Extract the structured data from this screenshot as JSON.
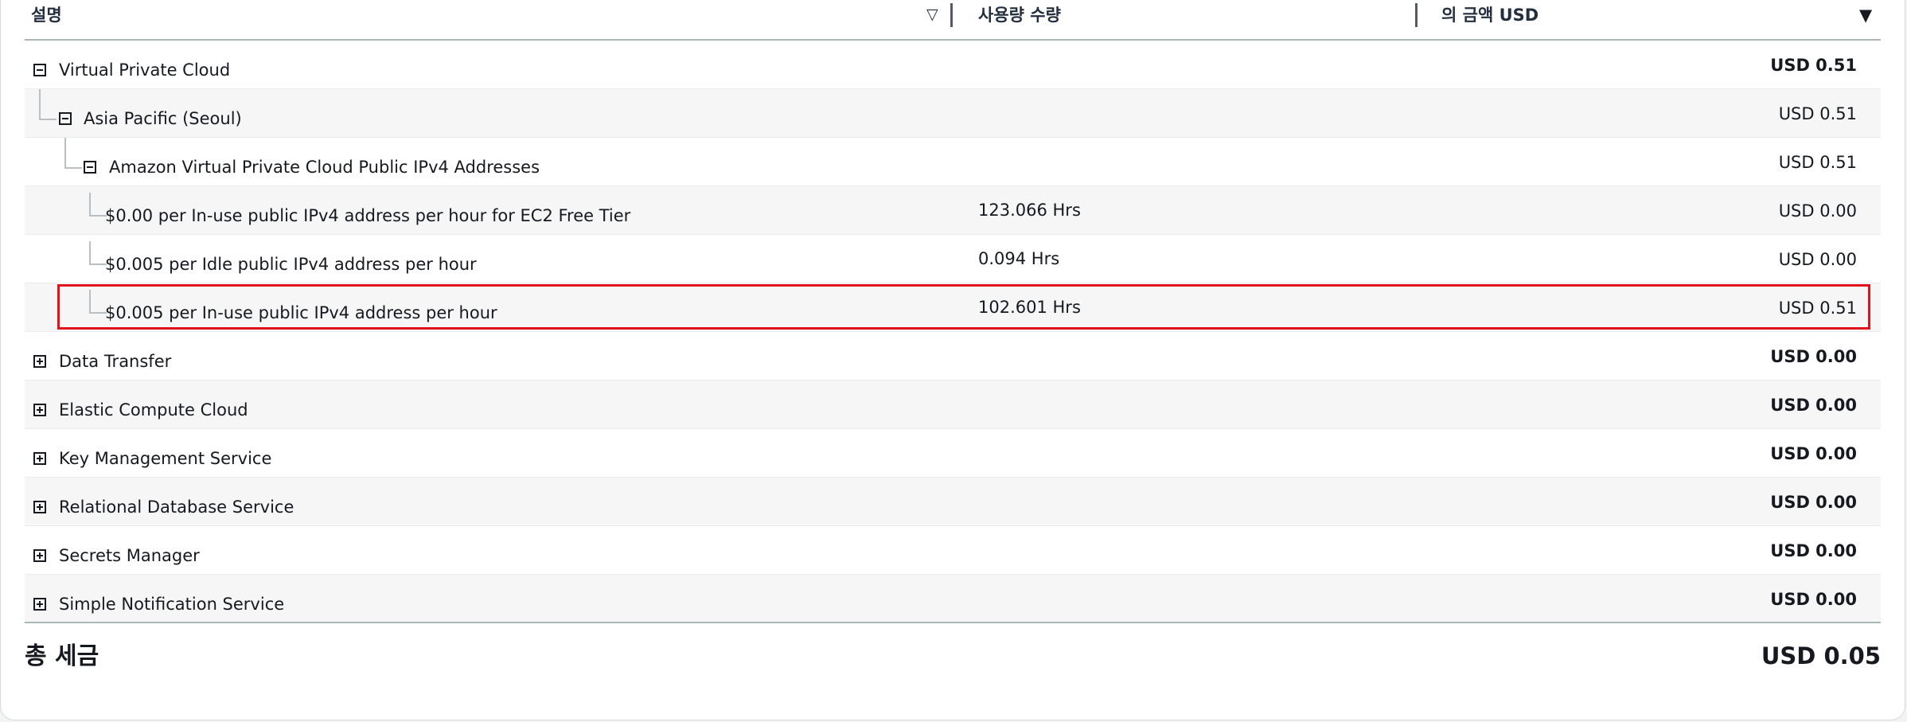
{
  "columns": {
    "description": "설명",
    "usage": "사용량 수량",
    "amount": "의 금액 USD"
  },
  "rows": [
    {
      "label": "Virtual Private Cloud",
      "usage": "",
      "amount": "USD 0.51"
    },
    {
      "label": "Asia Pacific (Seoul)",
      "usage": "",
      "amount": "USD 0.51"
    },
    {
      "label": "Amazon Virtual Private Cloud Public IPv4 Addresses",
      "usage": "",
      "amount": "USD 0.51"
    },
    {
      "label": "$0.00 per In-use public IPv4 address per hour for EC2 Free Tier",
      "usage": "123.066 Hrs",
      "amount": "USD 0.00"
    },
    {
      "label": "$0.005 per Idle public IPv4 address per hour",
      "usage": "0.094 Hrs",
      "amount": "USD 0.00"
    },
    {
      "label": "$0.005 per In-use public IPv4 address per hour",
      "usage": "102.601 Hrs",
      "amount": "USD 0.51"
    },
    {
      "label": "Data Transfer",
      "usage": "",
      "amount": "USD 0.00"
    },
    {
      "label": "Elastic Compute Cloud",
      "usage": "",
      "amount": "USD 0.00"
    },
    {
      "label": "Key Management Service",
      "usage": "",
      "amount": "USD 0.00"
    },
    {
      "label": "Relational Database Service",
      "usage": "",
      "amount": "USD 0.00"
    },
    {
      "label": "Secrets Manager",
      "usage": "",
      "amount": "USD 0.00"
    },
    {
      "label": "Simple Notification Service",
      "usage": "",
      "amount": "USD 0.00"
    }
  ],
  "total": {
    "label": "총 세금",
    "value": "USD 0.05"
  },
  "colors": {
    "highlight": "#e0121b",
    "alt_row": "#f6f6f7"
  },
  "icons": {
    "sort_desc": "filter-triangle-icon",
    "sort_caret": "caret-down-icon",
    "collapse": "minus-square-icon",
    "expand": "plus-square-icon"
  }
}
